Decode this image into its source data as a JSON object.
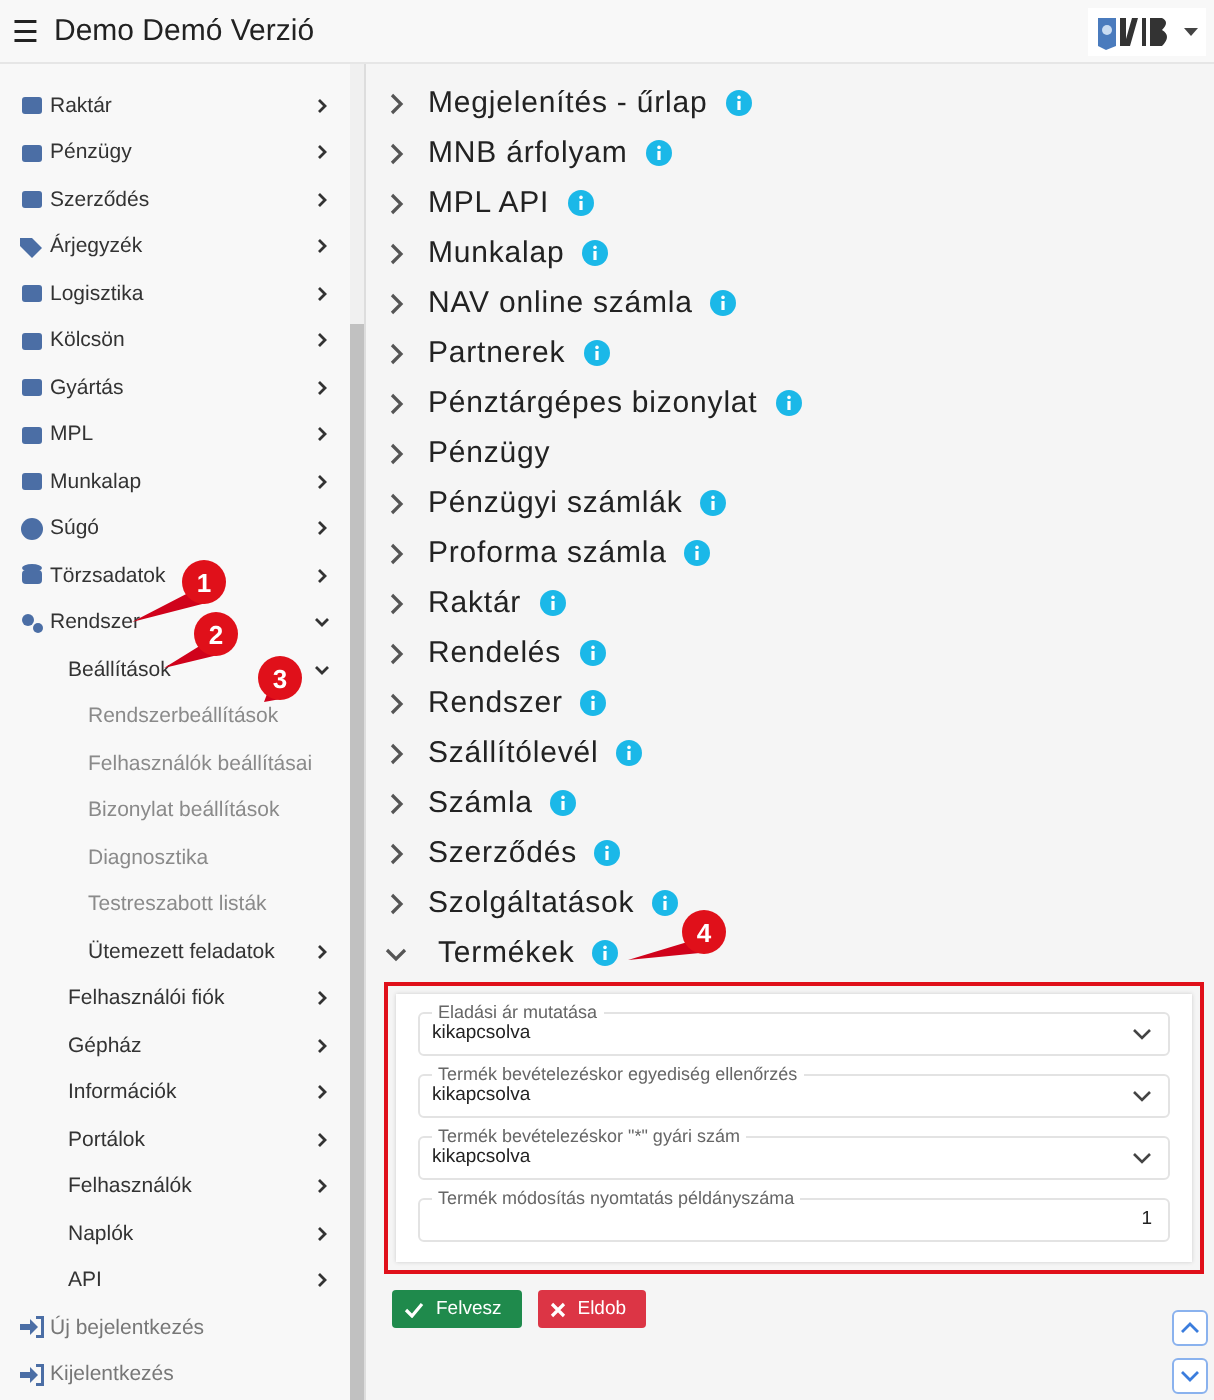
{
  "header": {
    "title": "Demo Demó Verzió",
    "menu_icon": "☰"
  },
  "sidebar": {
    "items": [
      {
        "label": "Raktár",
        "kind": "group",
        "expanded": false
      },
      {
        "label": "Pénzügy",
        "kind": "group",
        "expanded": false
      },
      {
        "label": "Szerződés",
        "kind": "group",
        "expanded": false
      },
      {
        "label": "Árjegyzék",
        "kind": "group",
        "expanded": false
      },
      {
        "label": "Logisztika",
        "kind": "group",
        "expanded": false
      },
      {
        "label": "Kölcsön",
        "kind": "group",
        "expanded": false
      },
      {
        "label": "Gyártás",
        "kind": "group",
        "expanded": false
      },
      {
        "label": "MPL",
        "kind": "group",
        "expanded": false
      },
      {
        "label": "Munkalap",
        "kind": "group",
        "expanded": false
      },
      {
        "label": "Súgó",
        "kind": "group",
        "expanded": false
      },
      {
        "label": "Törzsadatok",
        "kind": "group",
        "expanded": false
      },
      {
        "label": "Rendszer",
        "kind": "group",
        "expanded": true,
        "children": [
          {
            "label": "Beállítások",
            "kind": "group",
            "expanded": true,
            "children": [
              {
                "label": "Rendszerbeállítások",
                "kind": "leaf"
              },
              {
                "label": "Felhasználók beállításai",
                "kind": "leaf"
              },
              {
                "label": "Bizonylat beállítások",
                "kind": "leaf"
              },
              {
                "label": "Diagnosztika",
                "kind": "leaf"
              },
              {
                "label": "Testreszabott listák",
                "kind": "leaf"
              },
              {
                "label": "Ütemezett feladatok",
                "kind": "group",
                "expanded": false
              }
            ]
          },
          {
            "label": "Felhasználói fiók",
            "kind": "group",
            "expanded": false
          },
          {
            "label": "Gépház",
            "kind": "group",
            "expanded": false
          },
          {
            "label": "Információk",
            "kind": "group",
            "expanded": false
          },
          {
            "label": "Portálok",
            "kind": "group",
            "expanded": false
          },
          {
            "label": "Felhasználók",
            "kind": "group",
            "expanded": false
          },
          {
            "label": "Naplók",
            "kind": "group",
            "expanded": false
          },
          {
            "label": "API",
            "kind": "group",
            "expanded": false
          }
        ]
      },
      {
        "label": "Új bejelentkezés",
        "kind": "action"
      },
      {
        "label": "Kijelentkezés",
        "kind": "action"
      }
    ]
  },
  "sections": [
    {
      "name": "Megjelenítés - űrlap",
      "info": true,
      "expanded": false
    },
    {
      "name": "MNB árfolyam",
      "info": true,
      "expanded": false
    },
    {
      "name": "MPL API",
      "info": true,
      "expanded": false
    },
    {
      "name": "Munkalap",
      "info": true,
      "expanded": false
    },
    {
      "name": "NAV online számla",
      "info": true,
      "expanded": false
    },
    {
      "name": "Partnerek",
      "info": true,
      "expanded": false
    },
    {
      "name": "Pénztárgépes bizonylat",
      "info": true,
      "expanded": false
    },
    {
      "name": "Pénzügy",
      "info": false,
      "expanded": false
    },
    {
      "name": "Pénzügyi számlák",
      "info": true,
      "expanded": false
    },
    {
      "name": "Proforma számla",
      "info": true,
      "expanded": false
    },
    {
      "name": "Raktár",
      "info": true,
      "expanded": false
    },
    {
      "name": "Rendelés",
      "info": true,
      "expanded": false
    },
    {
      "name": "Rendszer",
      "info": true,
      "expanded": false
    },
    {
      "name": "Szállítólevél",
      "info": true,
      "expanded": false
    },
    {
      "name": "Számla",
      "info": true,
      "expanded": false
    },
    {
      "name": "Szerződés",
      "info": true,
      "expanded": false
    },
    {
      "name": "Szolgáltatások",
      "info": true,
      "expanded": false
    },
    {
      "name": "Termékek",
      "info": true,
      "expanded": true,
      "fields": [
        {
          "label": "Eladási ár mutatása",
          "kind": "select",
          "value": "kikapcsolva"
        },
        {
          "label": "Termék bevételezéskor egyediség ellenőrzés",
          "kind": "select",
          "value": "kikapcsolva"
        },
        {
          "label": "Termék bevételezéskor \"*\" gyári szám",
          "kind": "select",
          "value": "kikapcsolva"
        },
        {
          "label": "Termék módosítás nyomtatás példányszáma",
          "kind": "number",
          "value": "1"
        }
      ]
    }
  ],
  "buttons": [
    {
      "label": "Felvesz",
      "kind": "confirm"
    },
    {
      "label": "Eldob",
      "kind": "discard"
    }
  ],
  "callouts": [
    {
      "number": "1"
    },
    {
      "number": "2"
    },
    {
      "number": "3"
    },
    {
      "number": "4"
    }
  ]
}
